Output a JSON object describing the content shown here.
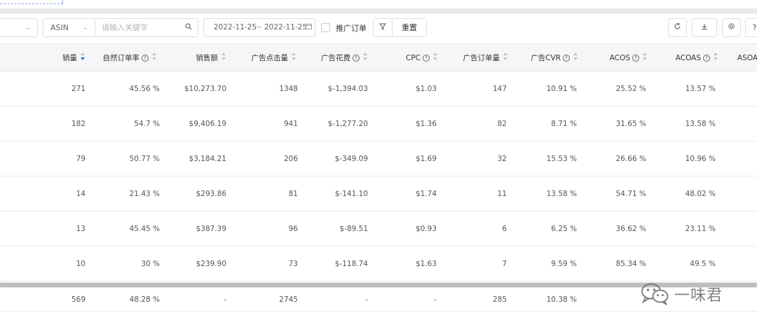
{
  "toolbar": {
    "field_select_value": "ASIN",
    "search_placeholder": "请输入关键字",
    "date_start": "2022-11-25",
    "date_separator": "~",
    "date_end": "2022-11-25",
    "ad_orders_label": "推广订单",
    "reset_label": "重置"
  },
  "table": {
    "headers": [
      {
        "label": "销量",
        "has_help": false,
        "sort": "desc"
      },
      {
        "label": "自然订单率",
        "has_help": true,
        "sort": "none"
      },
      {
        "label": "销售额",
        "has_help": false,
        "sort": "none"
      },
      {
        "label": "广告点击量",
        "has_help": false,
        "sort": "none"
      },
      {
        "label": "广告花费",
        "has_help": true,
        "sort": "none"
      },
      {
        "label": "CPC",
        "has_help": true,
        "sort": "none"
      },
      {
        "label": "广告订单量",
        "has_help": false,
        "sort": "none"
      },
      {
        "label": "广告CVR",
        "has_help": true,
        "sort": "none"
      },
      {
        "label": "ACOS",
        "has_help": true,
        "sort": "none"
      },
      {
        "label": "ACOAS",
        "has_help": true,
        "sort": "none"
      },
      {
        "label": "ASOA",
        "has_help": false,
        "sort": "none"
      }
    ],
    "rows": [
      [
        "271",
        "45.56 %",
        "$10,273.70",
        "1348",
        "$-1,394.03",
        "$1.03",
        "147",
        "10.91 %",
        "25.52 %",
        "13.57 %"
      ],
      [
        "182",
        "54.7 %",
        "$9,406.19",
        "941",
        "$-1,277.20",
        "$1.36",
        "82",
        "8.71 %",
        "31.65 %",
        "13.58 %"
      ],
      [
        "79",
        "50.77 %",
        "$3,184.21",
        "206",
        "$-349.09",
        "$1.69",
        "32",
        "15.53 %",
        "26.66 %",
        "10.96 %"
      ],
      [
        "14",
        "21.43 %",
        "$293.86",
        "81",
        "$-141.10",
        "$1.74",
        "11",
        "13.58 %",
        "54.71 %",
        "48.02 %"
      ],
      [
        "13",
        "45.45 %",
        "$387.39",
        "96",
        "$-89.51",
        "$0.93",
        "6",
        "6.25 %",
        "36.62 %",
        "23.11 %"
      ],
      [
        "10",
        "30 %",
        "$239.90",
        "73",
        "$-118.74",
        "$1.63",
        "7",
        "9.59 %",
        "85.34 %",
        "49.5 %"
      ]
    ],
    "totals": [
      "569",
      "48.28 %",
      "-",
      "2745",
      "-",
      "-",
      "285",
      "10.38 %",
      "",
      ""
    ]
  },
  "watermark": {
    "text": "一味君"
  },
  "colors": {
    "sort_active": "#2a6ad8",
    "header_bg": "#f5f6f8"
  }
}
